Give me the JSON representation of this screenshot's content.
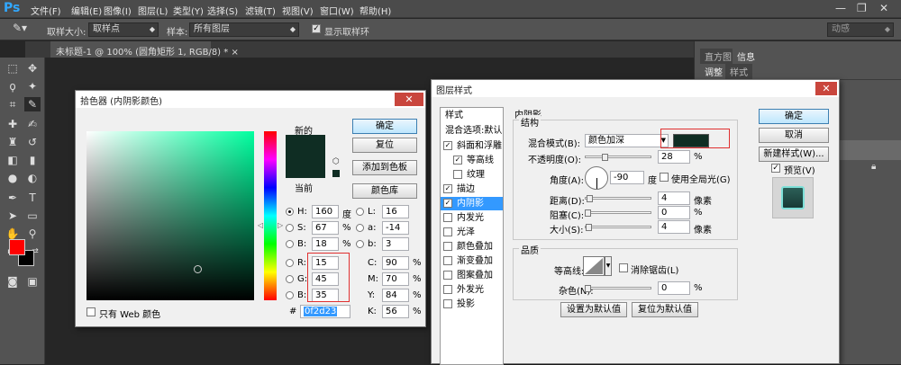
{
  "app": {
    "logo": "Ps"
  },
  "menu": [
    "文件(F)",
    "编辑(E)",
    "图像(I)",
    "图层(L)",
    "类型(Y)",
    "选择(S)",
    "滤镜(T)",
    "视图(V)",
    "窗口(W)",
    "帮助(H)"
  ],
  "window_controls": {
    "minimize": "—",
    "restore": "❐",
    "close": "✕"
  },
  "options": {
    "sample_size_label": "取样大小:",
    "sample_size_value": "取样点",
    "sample_label": "样本:",
    "sample_value": "所有图层",
    "show_ring_label": "显示取样环",
    "workspace": "动感"
  },
  "doc_tab": "未标题-1 @ 100% (圆角矩形 1, RGB/8) *",
  "right_panel": {
    "tabs": [
      "直方图",
      "信息"
    ],
    "tabs2": [
      "调整",
      "样式"
    ]
  },
  "picker": {
    "title": "拾色器 (内阴影颜色)",
    "new_label": "新的",
    "current_label": "当前",
    "ok": "确定",
    "reset": "复位",
    "add_swatch": "添加到色板",
    "libraries": "颜色库",
    "new_color": "#0f2d23",
    "current_color": "#0f2d23",
    "fields": [
      {
        "key": "H:",
        "value": "160",
        "unit": "度"
      },
      {
        "key": "S:",
        "value": "67",
        "unit": "%"
      },
      {
        "key": "B:",
        "value": "18",
        "unit": "%"
      },
      {
        "key": "R:",
        "value": "15",
        "unit": ""
      },
      {
        "key": "G:",
        "value": "45",
        "unit": ""
      },
      {
        "key": "B:",
        "value": "35",
        "unit": ""
      }
    ],
    "lab": [
      {
        "key": "L:",
        "value": "16"
      },
      {
        "key": "a:",
        "value": "-14"
      },
      {
        "key": "b:",
        "value": "3"
      }
    ],
    "cmyk": [
      {
        "key": "C:",
        "value": "90",
        "unit": "%"
      },
      {
        "key": "M:",
        "value": "70",
        "unit": "%"
      },
      {
        "key": "Y:",
        "value": "84",
        "unit": "%"
      },
      {
        "key": "K:",
        "value": "56",
        "unit": "%"
      }
    ],
    "hex_label": "#",
    "hex": "0f2d23",
    "web_only": "只有 Web 颜色"
  },
  "layer_style": {
    "title": "图层样式",
    "styles_header": "样式",
    "blend_default": "混合选项:默认",
    "items": [
      {
        "label": "斜面和浮雕",
        "checked": true,
        "indent": false
      },
      {
        "label": "等高线",
        "checked": true,
        "indent": true
      },
      {
        "label": "纹理",
        "checked": false,
        "indent": true
      },
      {
        "label": "描边",
        "checked": true,
        "indent": false
      },
      {
        "label": "内阴影",
        "checked": true,
        "indent": false,
        "selected": true
      },
      {
        "label": "内发光",
        "checked": false,
        "indent": false
      },
      {
        "label": "光泽",
        "checked": false,
        "indent": false
      },
      {
        "label": "颜色叠加",
        "checked": false,
        "indent": false
      },
      {
        "label": "渐变叠加",
        "checked": false,
        "indent": false
      },
      {
        "label": "图案叠加",
        "checked": false,
        "indent": false
      },
      {
        "label": "外发光",
        "checked": false,
        "indent": false
      },
      {
        "label": "投影",
        "checked": false,
        "indent": false
      }
    ],
    "section_title": "内阴影",
    "structure_label": "结构",
    "blend_mode_label": "混合模式(B):",
    "blend_mode_value": "颜色加深",
    "shadow_color": "#0f2d23",
    "opacity_label": "不透明度(O):",
    "opacity_value": "28",
    "opacity_unit": "%",
    "opacity": 0.28,
    "angle_label": "角度(A):",
    "angle_value": "-90",
    "angle_unit": "度",
    "global_light": "使用全局光(G)",
    "distance_label": "距离(D):",
    "distance_value": "4",
    "distance_unit": "像素",
    "choke_label": "阻塞(C):",
    "choke_value": "0",
    "choke_unit": "%",
    "size_label": "大小(S):",
    "size_value": "4",
    "size_unit": "像素",
    "quality_label": "品质",
    "contour_label": "等高线:",
    "antialias": "消除锯齿(L)",
    "noise_label": "杂色(N):",
    "noise_value": "0",
    "noise_unit": "%",
    "make_default": "设置为默认值",
    "reset_default": "复位为默认值",
    "ok": "确定",
    "cancel": "取消",
    "new_style": "新建样式(W)...",
    "preview": "预览(V)"
  }
}
